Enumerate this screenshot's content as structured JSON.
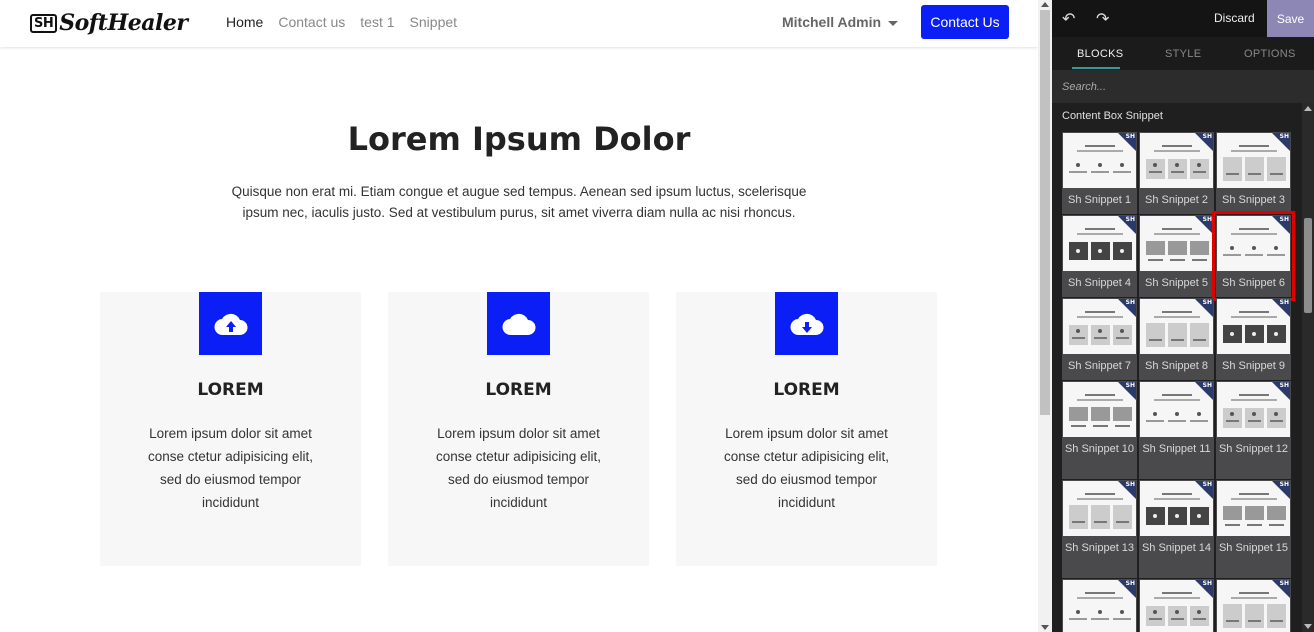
{
  "navbar": {
    "brand": "SoftHealer",
    "brand_mark": "SH",
    "links": [
      "Home",
      "Contact us",
      "test 1",
      "Snippet"
    ],
    "user": "Mitchell Admin",
    "contact_button": "Contact Us"
  },
  "hero": {
    "title": "Lorem Ipsum Dolor",
    "description": "Quisque non erat mi. Etiam congue et augue sed tempus. Aenean sed ipsum luctus, scelerisque ipsum nec, iaculis justo. Sed at vestibulum purus, sit amet viverra diam nulla ac nisi rhoncus."
  },
  "cards": [
    {
      "icon": "cloud-upload-icon",
      "title": "LOREM",
      "text": "Lorem ipsum dolor sit amet conse ctetur adipisicing elit, sed do eiusmod tempor incididunt"
    },
    {
      "icon": "cloud-icon",
      "title": "LOREM",
      "text": "Lorem ipsum dolor sit amet conse ctetur adipisicing elit, sed do eiusmod tempor incididunt"
    },
    {
      "icon": "cloud-download-icon",
      "title": "LOREM",
      "text": "Lorem ipsum dolor sit amet conse ctetur adipisicing elit, sed do eiusmod tempor incididunt"
    }
  ],
  "editor": {
    "discard": "Discard",
    "save": "Save",
    "tabs": [
      "BLOCKS",
      "STYLE",
      "OPTIONS"
    ],
    "active_tab": "BLOCKS",
    "search_placeholder": "Search...",
    "section": "Content Box Snippet",
    "badge": "SH",
    "snippets": [
      {
        "label": "Sh Snippet 1"
      },
      {
        "label": "Sh Snippet 2"
      },
      {
        "label": "Sh Snippet 3"
      },
      {
        "label": "Sh Snippet 4"
      },
      {
        "label": "Sh Snippet 5"
      },
      {
        "label": "Sh Snippet 6",
        "selected": true
      },
      {
        "label": "Sh Snippet 7"
      },
      {
        "label": "Sh Snippet 8"
      },
      {
        "label": "Sh Snippet 9"
      },
      {
        "label": "Sh Snippet 10"
      },
      {
        "label": "Sh Snippet 11"
      },
      {
        "label": "Sh Snippet 12"
      },
      {
        "label": "Sh Snippet 13"
      },
      {
        "label": "Sh Snippet 14"
      },
      {
        "label": "Sh Snippet 15"
      },
      {
        "label": ""
      },
      {
        "label": ""
      },
      {
        "label": ""
      }
    ]
  },
  "colors": {
    "accent_blue": "#0a1ef5",
    "save_purple": "#8c87b5",
    "panel_bg": "#1f1f20",
    "selection_red": "#e00000",
    "tab_underline": "#2d9c9a"
  }
}
